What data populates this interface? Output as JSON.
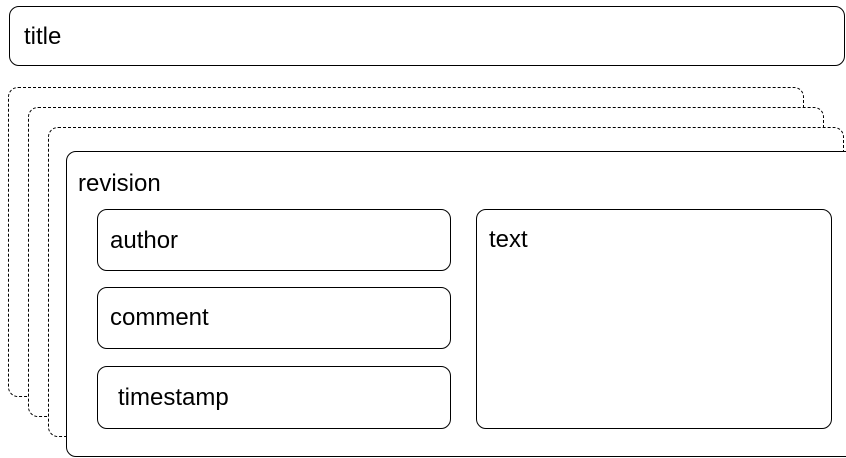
{
  "diagram": {
    "title_label": "title",
    "revision_label": "revision",
    "fields": {
      "author": "author",
      "comment": "comment",
      "timestamp": "timestamp",
      "text": "text"
    }
  }
}
